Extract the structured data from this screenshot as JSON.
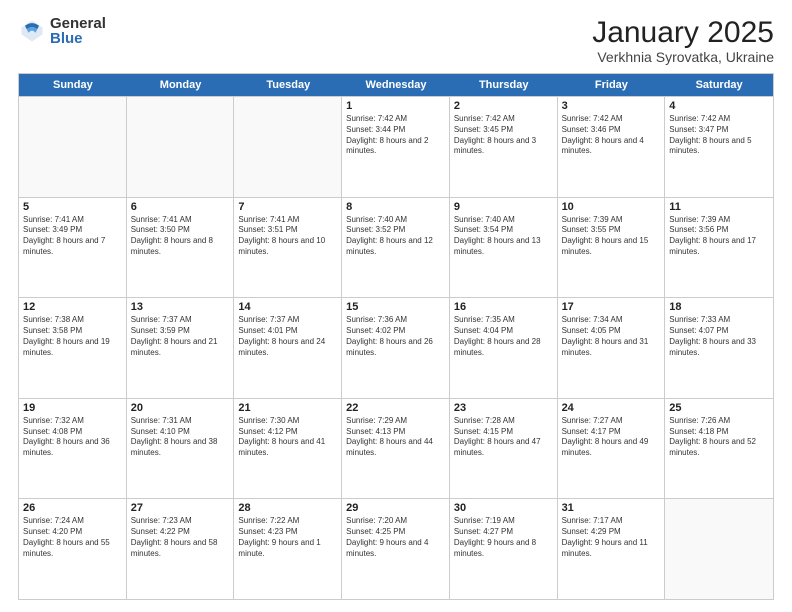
{
  "logo": {
    "general": "General",
    "blue": "Blue"
  },
  "title": "January 2025",
  "subtitle": "Verkhnia Syrovatka, Ukraine",
  "days": [
    "Sunday",
    "Monday",
    "Tuesday",
    "Wednesday",
    "Thursday",
    "Friday",
    "Saturday"
  ],
  "weeks": [
    [
      {
        "day": "",
        "content": ""
      },
      {
        "day": "",
        "content": ""
      },
      {
        "day": "",
        "content": ""
      },
      {
        "day": "1",
        "content": "Sunrise: 7:42 AM\nSunset: 3:44 PM\nDaylight: 8 hours and 2 minutes."
      },
      {
        "day": "2",
        "content": "Sunrise: 7:42 AM\nSunset: 3:45 PM\nDaylight: 8 hours and 3 minutes."
      },
      {
        "day": "3",
        "content": "Sunrise: 7:42 AM\nSunset: 3:46 PM\nDaylight: 8 hours and 4 minutes."
      },
      {
        "day": "4",
        "content": "Sunrise: 7:42 AM\nSunset: 3:47 PM\nDaylight: 8 hours and 5 minutes."
      }
    ],
    [
      {
        "day": "5",
        "content": "Sunrise: 7:41 AM\nSunset: 3:49 PM\nDaylight: 8 hours and 7 minutes."
      },
      {
        "day": "6",
        "content": "Sunrise: 7:41 AM\nSunset: 3:50 PM\nDaylight: 8 hours and 8 minutes."
      },
      {
        "day": "7",
        "content": "Sunrise: 7:41 AM\nSunset: 3:51 PM\nDaylight: 8 hours and 10 minutes."
      },
      {
        "day": "8",
        "content": "Sunrise: 7:40 AM\nSunset: 3:52 PM\nDaylight: 8 hours and 12 minutes."
      },
      {
        "day": "9",
        "content": "Sunrise: 7:40 AM\nSunset: 3:54 PM\nDaylight: 8 hours and 13 minutes."
      },
      {
        "day": "10",
        "content": "Sunrise: 7:39 AM\nSunset: 3:55 PM\nDaylight: 8 hours and 15 minutes."
      },
      {
        "day": "11",
        "content": "Sunrise: 7:39 AM\nSunset: 3:56 PM\nDaylight: 8 hours and 17 minutes."
      }
    ],
    [
      {
        "day": "12",
        "content": "Sunrise: 7:38 AM\nSunset: 3:58 PM\nDaylight: 8 hours and 19 minutes."
      },
      {
        "day": "13",
        "content": "Sunrise: 7:37 AM\nSunset: 3:59 PM\nDaylight: 8 hours and 21 minutes."
      },
      {
        "day": "14",
        "content": "Sunrise: 7:37 AM\nSunset: 4:01 PM\nDaylight: 8 hours and 24 minutes."
      },
      {
        "day": "15",
        "content": "Sunrise: 7:36 AM\nSunset: 4:02 PM\nDaylight: 8 hours and 26 minutes."
      },
      {
        "day": "16",
        "content": "Sunrise: 7:35 AM\nSunset: 4:04 PM\nDaylight: 8 hours and 28 minutes."
      },
      {
        "day": "17",
        "content": "Sunrise: 7:34 AM\nSunset: 4:05 PM\nDaylight: 8 hours and 31 minutes."
      },
      {
        "day": "18",
        "content": "Sunrise: 7:33 AM\nSunset: 4:07 PM\nDaylight: 8 hours and 33 minutes."
      }
    ],
    [
      {
        "day": "19",
        "content": "Sunrise: 7:32 AM\nSunset: 4:08 PM\nDaylight: 8 hours and 36 minutes."
      },
      {
        "day": "20",
        "content": "Sunrise: 7:31 AM\nSunset: 4:10 PM\nDaylight: 8 hours and 38 minutes."
      },
      {
        "day": "21",
        "content": "Sunrise: 7:30 AM\nSunset: 4:12 PM\nDaylight: 8 hours and 41 minutes."
      },
      {
        "day": "22",
        "content": "Sunrise: 7:29 AM\nSunset: 4:13 PM\nDaylight: 8 hours and 44 minutes."
      },
      {
        "day": "23",
        "content": "Sunrise: 7:28 AM\nSunset: 4:15 PM\nDaylight: 8 hours and 47 minutes."
      },
      {
        "day": "24",
        "content": "Sunrise: 7:27 AM\nSunset: 4:17 PM\nDaylight: 8 hours and 49 minutes."
      },
      {
        "day": "25",
        "content": "Sunrise: 7:26 AM\nSunset: 4:18 PM\nDaylight: 8 hours and 52 minutes."
      }
    ],
    [
      {
        "day": "26",
        "content": "Sunrise: 7:24 AM\nSunset: 4:20 PM\nDaylight: 8 hours and 55 minutes."
      },
      {
        "day": "27",
        "content": "Sunrise: 7:23 AM\nSunset: 4:22 PM\nDaylight: 8 hours and 58 minutes."
      },
      {
        "day": "28",
        "content": "Sunrise: 7:22 AM\nSunset: 4:23 PM\nDaylight: 9 hours and 1 minute."
      },
      {
        "day": "29",
        "content": "Sunrise: 7:20 AM\nSunset: 4:25 PM\nDaylight: 9 hours and 4 minutes."
      },
      {
        "day": "30",
        "content": "Sunrise: 7:19 AM\nSunset: 4:27 PM\nDaylight: 9 hours and 8 minutes."
      },
      {
        "day": "31",
        "content": "Sunrise: 7:17 AM\nSunset: 4:29 PM\nDaylight: 9 hours and 11 minutes."
      },
      {
        "day": "",
        "content": ""
      }
    ]
  ]
}
